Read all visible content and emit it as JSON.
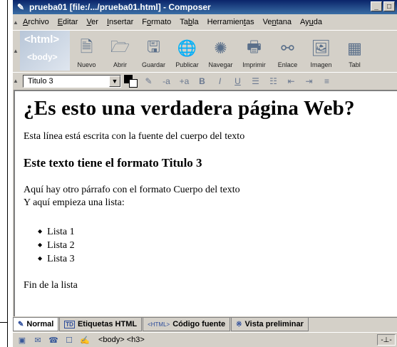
{
  "window": {
    "title": "prueba01 [file:/.../prueba01.html] - Composer",
    "minimize": "_",
    "maximize": "□"
  },
  "menu": {
    "items": [
      {
        "pre": "",
        "ul": "A",
        "post": "rchivo"
      },
      {
        "pre": "",
        "ul": "E",
        "post": "ditar"
      },
      {
        "pre": "",
        "ul": "V",
        "post": "er"
      },
      {
        "pre": "",
        "ul": "I",
        "post": "nsertar"
      },
      {
        "pre": "F",
        "ul": "o",
        "post": "rmato"
      },
      {
        "pre": "Ta",
        "ul": "b",
        "post": "la"
      },
      {
        "pre": "Herramien",
        "ul": "t",
        "post": "as"
      },
      {
        "pre": "Ve",
        "ul": "n",
        "post": "tana"
      },
      {
        "pre": "Ay",
        "ul": "u",
        "post": "da"
      }
    ]
  },
  "toolbar": {
    "badge_top": "<html>",
    "badge_bottom": "<body>",
    "buttons": [
      {
        "label": "Nuevo",
        "icon": "new-document-icon",
        "glyph": "🗎"
      },
      {
        "label": "Abrir",
        "icon": "open-folder-icon",
        "glyph": "🗁"
      },
      {
        "label": "Guardar",
        "icon": "save-icon",
        "glyph": "🖫"
      },
      {
        "label": "Publicar",
        "icon": "publish-icon",
        "glyph": "🌐"
      },
      {
        "label": "Navegar",
        "icon": "browse-icon",
        "glyph": "✺"
      },
      {
        "label": "Imprimir",
        "icon": "print-icon",
        "glyph": "🖶"
      },
      {
        "label": "Enlace",
        "icon": "link-icon",
        "glyph": "⚯"
      },
      {
        "label": "Imagen",
        "icon": "image-icon",
        "glyph": "🖼"
      },
      {
        "label": "Tabl",
        "icon": "table-icon",
        "glyph": "▦"
      }
    ]
  },
  "format": {
    "style_value": "Titulo 3",
    "buttons": [
      {
        "name": "highlight-icon",
        "glyph": "✎"
      },
      {
        "name": "smaller-font-icon",
        "glyph": "-a"
      },
      {
        "name": "larger-font-icon",
        "glyph": "+a"
      },
      {
        "name": "bold-icon",
        "glyph": "B"
      },
      {
        "name": "italic-icon",
        "glyph": "I"
      },
      {
        "name": "underline-icon",
        "glyph": "U"
      },
      {
        "name": "bullet-list-icon",
        "glyph": "☰"
      },
      {
        "name": "numbered-list-icon",
        "glyph": "☷"
      },
      {
        "name": "outdent-icon",
        "glyph": "⇤"
      },
      {
        "name": "indent-icon",
        "glyph": "⇥"
      },
      {
        "name": "align-icon",
        "glyph": "≡"
      }
    ]
  },
  "document": {
    "heading1": "¿Es esto una verdadera página Web?",
    "p1": "Esta línea está escrita con la fuente del cuerpo del texto",
    "heading3": "Este texto tiene el formato Titulo 3",
    "p2_line1": "Aquí hay otro párrafo con el formato Cuerpo del texto",
    "p2_line2": "Y aquí empieza una lista:",
    "list": [
      "Lista 1",
      "Lista 2",
      "Lista 3"
    ],
    "p4": "Fin de la lista"
  },
  "tabs": [
    {
      "label": "Normal",
      "icon": "pencil-icon",
      "glyph": "✎"
    },
    {
      "label": "Etiquetas HTML",
      "icon": "tags-icon",
      "glyph": "TD"
    },
    {
      "label": "Código fuente",
      "icon": "source-icon",
      "glyph": "<HTML>"
    },
    {
      "label": "Vista preliminar",
      "icon": "preview-icon",
      "glyph": "※"
    }
  ],
  "status": {
    "tags": "<body> <h3>",
    "right": "-⊥-"
  }
}
